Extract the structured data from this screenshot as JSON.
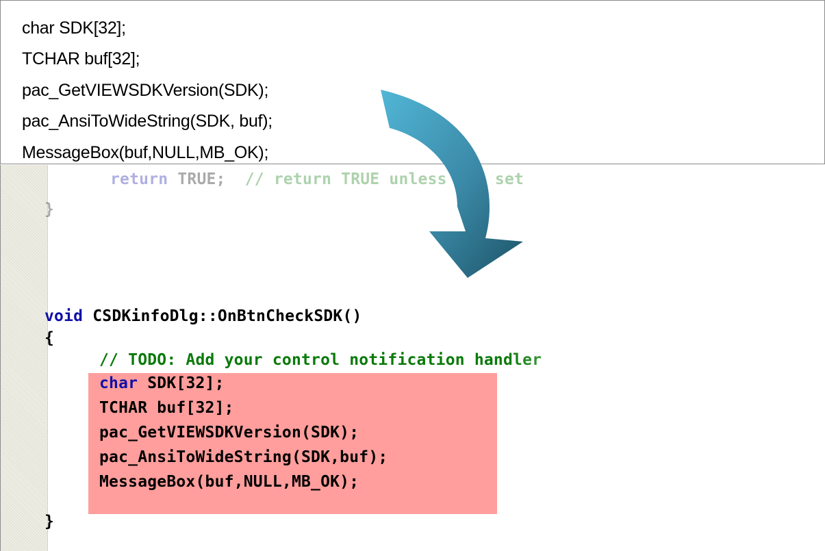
{
  "snippet": {
    "lines": [
      "char SDK[32];",
      "TCHAR buf[32];",
      "pac_GetVIEWSDKVersion(SDK);",
      "pac_AnsiToWideString(SDK, buf);",
      "MessageBox(buf,NULL,MB_OK);"
    ]
  },
  "editor": {
    "faded_return_kw": "return",
    "faded_return_val": " TRUE;  ",
    "faded_return_comment": "// return TRUE unless you set",
    "faded_close_brace": "}",
    "func_kw": "void",
    "func_signature": " CSDKinfoDlg::OnBtnCheckSDK()",
    "open_brace": "{",
    "todo_comment": "// TODO: Add your control notification handler",
    "highlighted": {
      "line1_kw": "char",
      "line1_rest": " SDK[32];",
      "line2": "TCHAR buf[32];",
      "line3": "pac_GetVIEWSDKVersion(SDK);",
      "line4": "pac_AnsiToWideString(SDK,buf);",
      "line5": "MessageBox(buf,NULL,MB_OK);"
    },
    "close_brace": "}"
  },
  "colors": {
    "keyword": "#1010a8",
    "comment": "#0a7a0a",
    "highlight": "#ff9e9c",
    "arrow_light": "#4aaccc",
    "arrow_dark": "#1f5a6e"
  },
  "icons": {
    "arrow": "curved-arrow-down-icon"
  }
}
